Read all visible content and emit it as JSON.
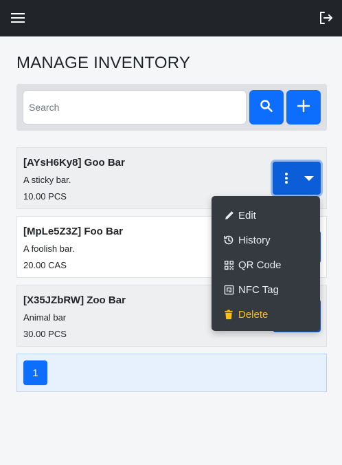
{
  "navbar": {
    "menu_icon": "hamburger-icon",
    "logout_icon": "logout-icon"
  },
  "page": {
    "title": "MANAGE INVENTORY"
  },
  "search": {
    "placeholder": "Search",
    "value": "",
    "search_icon": "search-icon",
    "add_icon": "plus-icon"
  },
  "items": [
    {
      "title": "[AYsH6Ky8] Goo Bar",
      "description": "A sticky bar.",
      "quantity": "10.00 PCS"
    },
    {
      "title": "[MpLe5Z3Z] Foo Bar",
      "description": "A foolish bar.",
      "quantity": "20.00 CAS"
    },
    {
      "title": "[X35JZbRW] Zoo Bar",
      "description": "Animal bar",
      "quantity": "30.00 PCS"
    }
  ],
  "pagination": {
    "current_page": "1"
  },
  "dropdown": {
    "items": [
      {
        "label": "Edit",
        "icon": "pencil-icon"
      },
      {
        "label": "History",
        "icon": "history-icon"
      },
      {
        "label": "QR Code",
        "icon": "qr-code-icon"
      },
      {
        "label": "NFC Tag",
        "icon": "nfc-tag-icon"
      },
      {
        "label": "Delete",
        "icon": "trash-icon"
      }
    ]
  },
  "colors": {
    "navbar": "#212529",
    "primary": "#0d6efd",
    "danger_text": "#ffc107",
    "dropdown_bg": "#343a40"
  }
}
